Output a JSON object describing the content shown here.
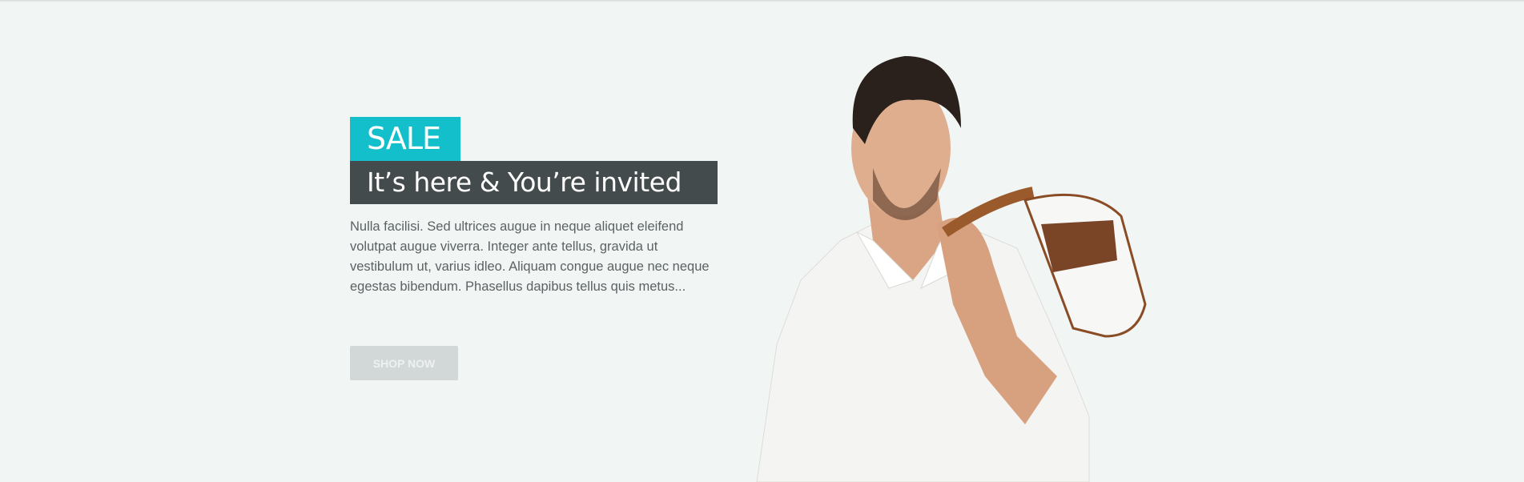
{
  "banner": {
    "badge": "SALE",
    "headline": "It’s here & You’re invited",
    "description": "Nulla facilisi. Sed ultrices augue in neque aliquet eleifend volutpat augue viverra. Integer ante tellus, gravida ut vestibulum ut, varius idleo. Aliquam congue augue nec neque egestas bibendum. Phasellus dapibus tellus quis metus...",
    "cta_label": "SHOP NOW"
  },
  "colors": {
    "accent": "#13bfcb",
    "headline_bg": "#444b4d",
    "background": "#f1f6f5",
    "button": "#d2d7d7"
  }
}
